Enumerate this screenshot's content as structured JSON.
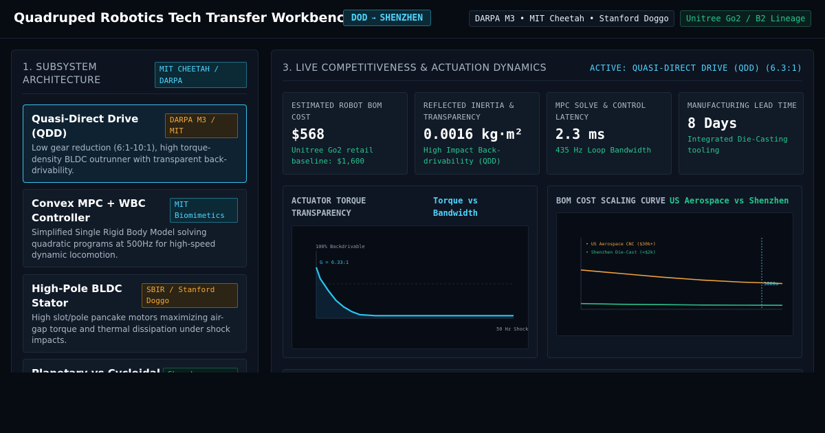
{
  "header": {
    "title": "Quadruped Robotics Tech Transfer Workbench",
    "route_from": "DOD",
    "route_arrow": "→",
    "route_to": "SHENZHEN",
    "programs": "DARPA M3 • MIT Cheetah • Stanford Doggo",
    "lineage": "Unitree Go2 / B2 Lineage"
  },
  "subsystems": {
    "heading": "1. SUBSYSTEM ARCHITECTURE",
    "source_badge": "MIT CHEETAH / DARPA",
    "cards": [
      {
        "title": "Quasi-Direct Drive (QDD)",
        "tag": "DARPA M3 / MIT",
        "desc": "Low gear reduction (6:1-10:1), high torque-density BLDC outrunner with transparent back-drivability."
      },
      {
        "title": "Convex MPC + WBC Controller",
        "tag": "MIT Biomimetics",
        "desc": "Simplified Single Rigid Body Model solving quadratic programs at 500Hz for high-speed dynamic locomotion."
      },
      {
        "title": "High-Pole BLDC Stator",
        "tag": "SBIR / Stanford Doggo",
        "desc": "High slot/pole pancake motors maximizing air-gap torque and thermal dissipation under shock impacts."
      },
      {
        "title": "Planetary vs Cycloidal",
        "tag": "Shenzhen"
      }
    ]
  },
  "dynamics": {
    "heading": "3. LIVE COMPETITIVENESS & ACTUATION DYNAMICS",
    "active": "ACTIVE: QUASI-DIRECT DRIVE (QDD) (6.3:1)",
    "kpis": [
      {
        "label": "ESTIMATED ROBOT BOM COST",
        "value": "$568",
        "note": "Unitree Go2 retail baseline: $1,600"
      },
      {
        "label": "REFLECTED INERTIA & TRANSPARENCY",
        "value": "0.0016 kg·m²",
        "note": "High Impact Back-drivability (QDD)"
      },
      {
        "label": "MPC SOLVE & CONTROL LATENCY",
        "value": "2.3 ms",
        "note": "435 Hz Loop Bandwidth"
      },
      {
        "label": "MANUFACTURING LEAD TIME",
        "value": "8 Days",
        "note": "Integrated Die-Casting tooling"
      }
    ]
  },
  "chart_data": [
    {
      "type": "line",
      "title": "ACTUATOR TORQUE TRANSPARENCY",
      "subtitle": "Torque vs Bandwidth",
      "top_label": "100% Backdrivable",
      "annotation": "G = 6.33:1",
      "x_label": "50 Hz Shock",
      "series": [
        {
          "name": "",
          "color": "#29c6f2",
          "x": [
            0,
            0.02,
            0.06,
            0.1,
            0.14,
            0.18,
            0.22,
            0.3,
            0.5,
            1.0
          ],
          "y": [
            1.0,
            0.78,
            0.55,
            0.35,
            0.22,
            0.13,
            0.07,
            0.05,
            0.05,
            0.05
          ]
        }
      ]
    },
    {
      "type": "line",
      "title": "BOM COST SCALING CURVE",
      "subtitle": "US Aerospace vs Shenzhen",
      "marker_label": "5000u",
      "legend": [
        "• US Aerospace CNC ($30k+)",
        "• Shenzhen Die-Cast (<$2k)"
      ],
      "series": [
        {
          "name": "US Aerospace CNC ($30k+)",
          "color": "#f0a23b",
          "x": [
            0,
            0.2,
            0.4,
            0.6,
            0.8,
            0.9,
            1.0
          ],
          "y": [
            0.55,
            0.5,
            0.45,
            0.41,
            0.38,
            0.37,
            0.36
          ]
        },
        {
          "name": "Shenzhen Die-Cast (<$2k)",
          "color": "#2bc08c",
          "x": [
            0,
            0.2,
            0.4,
            0.6,
            0.8,
            0.9,
            1.0
          ],
          "y": [
            0.08,
            0.07,
            0.065,
            0.06,
            0.058,
            0.057,
            0.056
          ]
        }
      ]
    }
  ]
}
